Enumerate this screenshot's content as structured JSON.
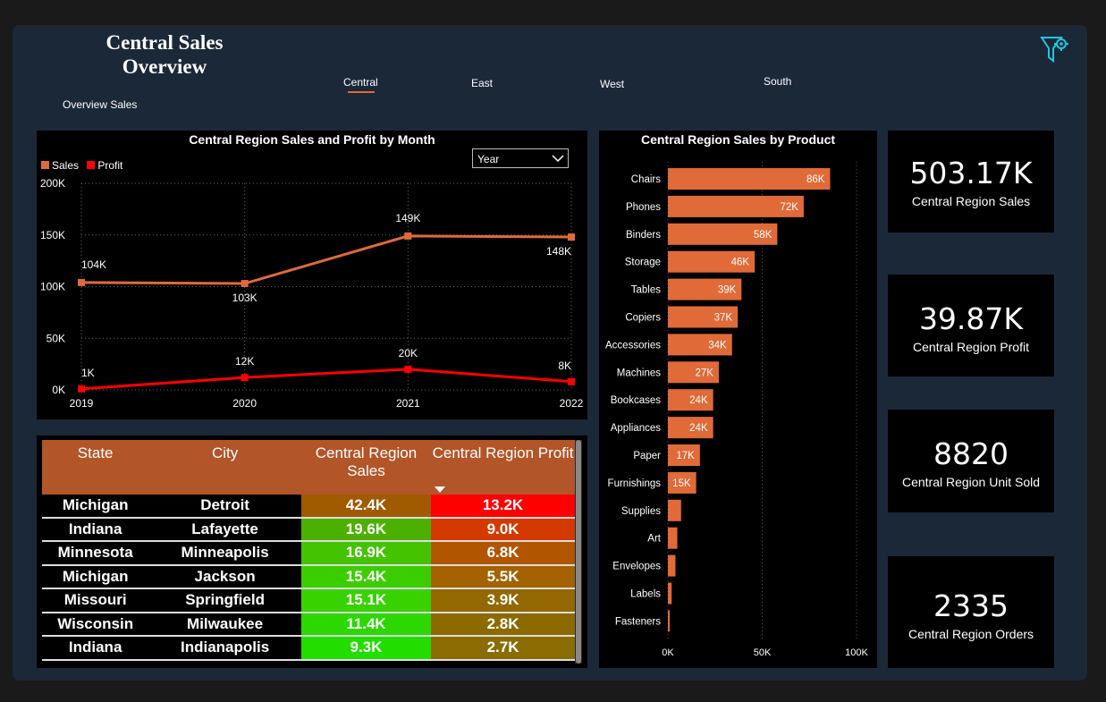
{
  "header": {
    "title_line1": "Central  Sales",
    "title_line2": "Overview",
    "subtitle": "Overview Sales"
  },
  "tabs": [
    {
      "label": "Central",
      "active": true
    },
    {
      "label": "East",
      "active": false
    },
    {
      "label": "West",
      "active": false
    },
    {
      "label": "South",
      "active": false
    }
  ],
  "icons": {
    "filter": "filter-settings-icon",
    "dropdown": "chevron-down-icon"
  },
  "colors": {
    "sales": "#e06a38",
    "profit": "#ff0000",
    "panel": "#1b2838",
    "header_row": "#b25529"
  },
  "line_chart": {
    "title": "Central Region Sales and Profit by Month",
    "dropdown_value": "Year",
    "legend": [
      "Sales",
      "Profit"
    ],
    "y_ticks": [
      "200K",
      "150K",
      "100K",
      "50K",
      "0K"
    ],
    "x_ticks": [
      "2019",
      "2020",
      "2021",
      "2022"
    ]
  },
  "bar_chart": {
    "title": "Central Region Sales by Product",
    "x_ticks": [
      "0K",
      "50K",
      "100K"
    ]
  },
  "chart_data": [
    {
      "type": "line",
      "title": "Central Region Sales and Profit by Month",
      "x": [
        "2019",
        "2020",
        "2021",
        "2022"
      ],
      "series": [
        {
          "name": "Sales",
          "values": [
            104000,
            103000,
            149000,
            148000
          ],
          "labels": [
            "104K",
            "103K",
            "149K",
            "148K"
          ]
        },
        {
          "name": "Profit",
          "values": [
            1000,
            12000,
            20000,
            8000
          ],
          "labels": [
            "1K",
            "12K",
            "20K",
            "8K"
          ]
        }
      ],
      "ylim": [
        0,
        200000
      ],
      "grid": true,
      "legend_position": "top-left"
    },
    {
      "type": "bar",
      "orientation": "horizontal",
      "title": "Central Region Sales by Product",
      "categories": [
        "Chairs",
        "Phones",
        "Binders",
        "Storage",
        "Tables",
        "Copiers",
        "Accessories",
        "Machines",
        "Bookcases",
        "Appliances",
        "Paper",
        "Furnishings",
        "Supplies",
        "Art",
        "Envelopes",
        "Labels",
        "Fasteners"
      ],
      "values": [
        86000,
        72000,
        58000,
        46000,
        39000,
        37000,
        34000,
        27000,
        24000,
        24000,
        17000,
        15000,
        7000,
        5000,
        4000,
        2000,
        1000
      ],
      "labels": [
        "86K",
        "72K",
        "58K",
        "46K",
        "39K",
        "37K",
        "34K",
        "27K",
        "24K",
        "24K",
        "17K",
        "15K",
        "",
        "",
        "",
        "",
        ""
      ],
      "xlim": [
        0,
        100000
      ],
      "grid": true
    }
  ],
  "kpis": [
    {
      "value": "503.17K",
      "label": "Central Region Sales"
    },
    {
      "value": "39.87K",
      "label": "Central Region Profit"
    },
    {
      "value": "8820",
      "label": "Central Region Unit Sold"
    },
    {
      "value": "2335",
      "label": "Central Region Orders"
    }
  ],
  "table": {
    "headers": [
      "State",
      "City",
      "Central Region Sales",
      "Central Region Profit"
    ],
    "rows": [
      {
        "state": "Michigan",
        "city": "Detroit",
        "sales": "42.4K",
        "profit": "13.2K",
        "sales_color": "#a05a00",
        "profit_color": "#ff0000"
      },
      {
        "state": "Indiana",
        "city": "Lafayette",
        "sales": "19.6K",
        "profit": "9.0K",
        "sales_color": "#4cb000",
        "profit_color": "#d43a00"
      },
      {
        "state": "Minnesota",
        "city": "Minneapolis",
        "sales": "16.9K",
        "profit": "6.8K",
        "sales_color": "#44c400",
        "profit_color": "#b25500"
      },
      {
        "state": "Michigan",
        "city": "Jackson",
        "sales": "15.4K",
        "profit": "5.5K",
        "sales_color": "#3ccd00",
        "profit_color": "#a46200"
      },
      {
        "state": "Missouri",
        "city": "Springfield",
        "sales": "15.1K",
        "profit": "3.9K",
        "sales_color": "#38d200",
        "profit_color": "#946800"
      },
      {
        "state": "Wisconsin",
        "city": "Milwaukee",
        "sales": "11.4K",
        "profit": "2.8K",
        "sales_color": "#2cd800",
        "profit_color": "#8c6a00"
      },
      {
        "state": "Indiana",
        "city": "Indianapolis",
        "sales": "9.3K",
        "profit": "2.7K",
        "sales_color": "#22dd00",
        "profit_color": "#8a6c00"
      }
    ]
  }
}
